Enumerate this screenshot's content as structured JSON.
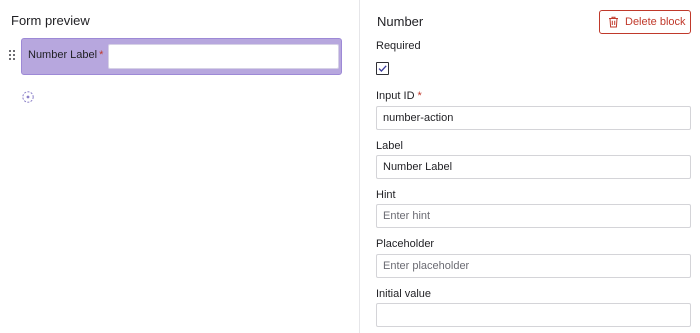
{
  "preview": {
    "title": "Form preview",
    "field_label": "Number Label",
    "required_mark": "*",
    "field_value": ""
  },
  "properties": {
    "title": "Number",
    "delete_label": "Delete block",
    "required_label": "Required",
    "required_checked": true,
    "input_id_label": "Input ID",
    "input_id_required_mark": "*",
    "input_id_value": "number-action",
    "label_label": "Label",
    "label_value": "Number Label",
    "hint_label": "Hint",
    "hint_placeholder": "Enter hint",
    "placeholder_label": "Placeholder",
    "placeholder_placeholder": "Enter placeholder",
    "initial_value_label": "Initial value",
    "initial_value_value": ""
  },
  "colors": {
    "accent": "#b7a7de",
    "danger": "#c0392b"
  }
}
